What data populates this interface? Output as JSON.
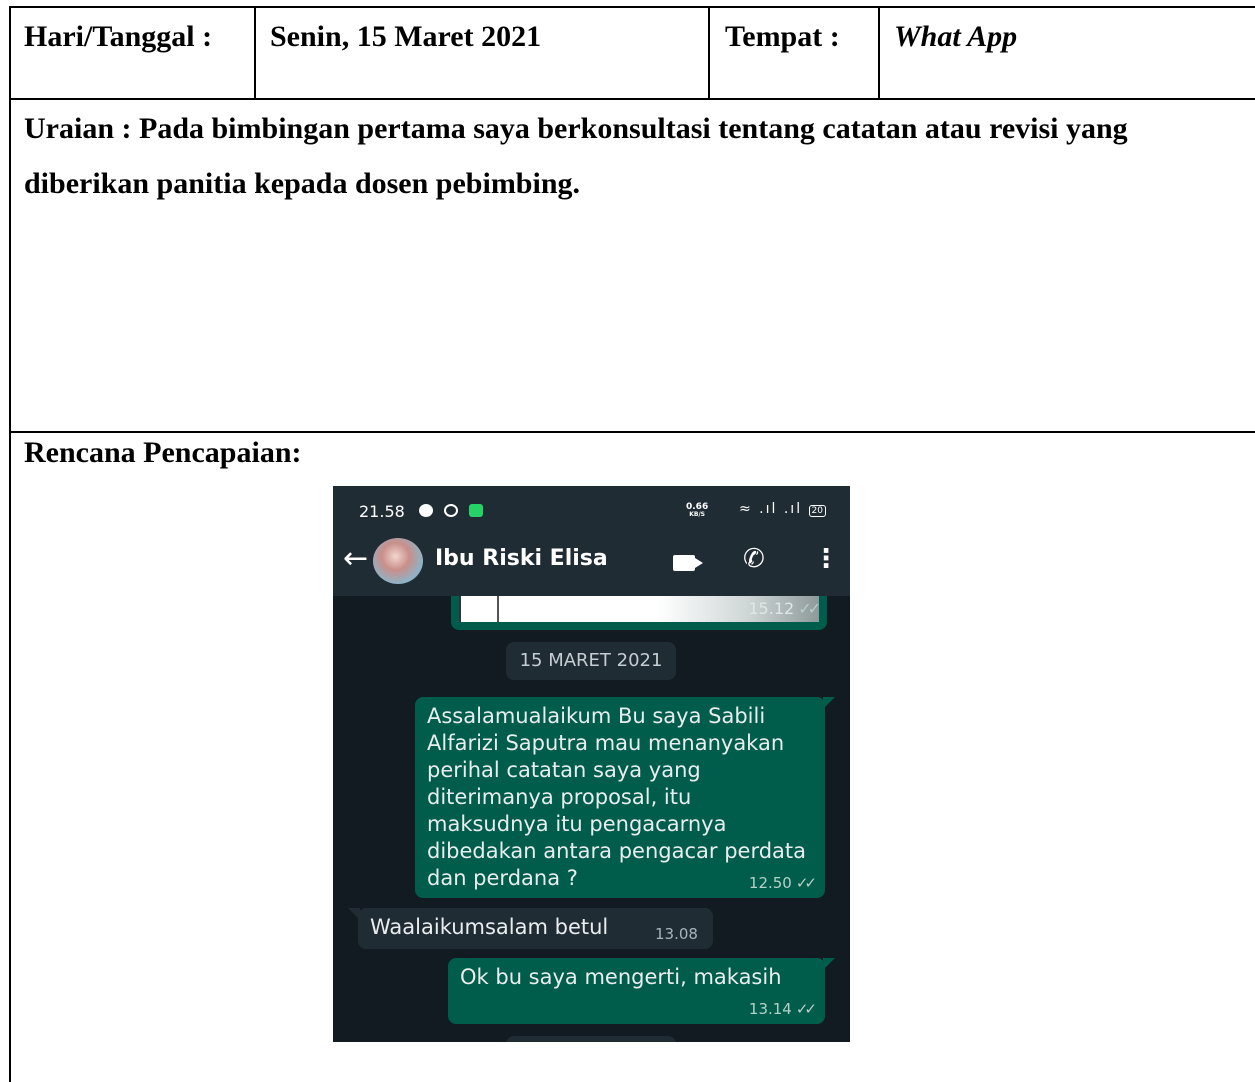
{
  "document": {
    "row1": {
      "day_label": "Hari/Tanggal :",
      "day_value": "Senin, 15 Maret 2021",
      "place_label": "Tempat :",
      "place_value": "What App"
    },
    "uraian": "Uraian : Pada bimbingan pertama saya berkonsultasi tentang catatan atau revisi yang diberikan panitia kepada dosen pebimbing.",
    "rencana_label": "Rencana Pencapaian:"
  },
  "phone": {
    "status_time": "21.58",
    "status_speed": "0.66",
    "status_speed_unit": "KB/S",
    "battery": "20",
    "contact_name": "Ibu Riski Elisa",
    "prev_message_time": "15.12",
    "date_separator": "15 MARET 2021",
    "messages": [
      {
        "direction": "out",
        "text": "Assalamualaikum Bu saya Sabili Alfarizi Saputra mau menanyakan perihal catatan saya yang diterimanya proposal, itu maksudnya itu pengacarnya dibedakan antara pengacar perdata dan perdana ?",
        "time": "12.50"
      },
      {
        "direction": "in",
        "text": "Waalaikumsalam betul",
        "time": "13.08"
      },
      {
        "direction": "out",
        "text": "Ok bu saya mengerti, makasih",
        "time": "13.14"
      }
    ],
    "colors": {
      "background": "#111b21",
      "header": "#1f2c34",
      "outgoing_bubble": "#005c4b",
      "incoming_bubble": "#202c33"
    }
  }
}
